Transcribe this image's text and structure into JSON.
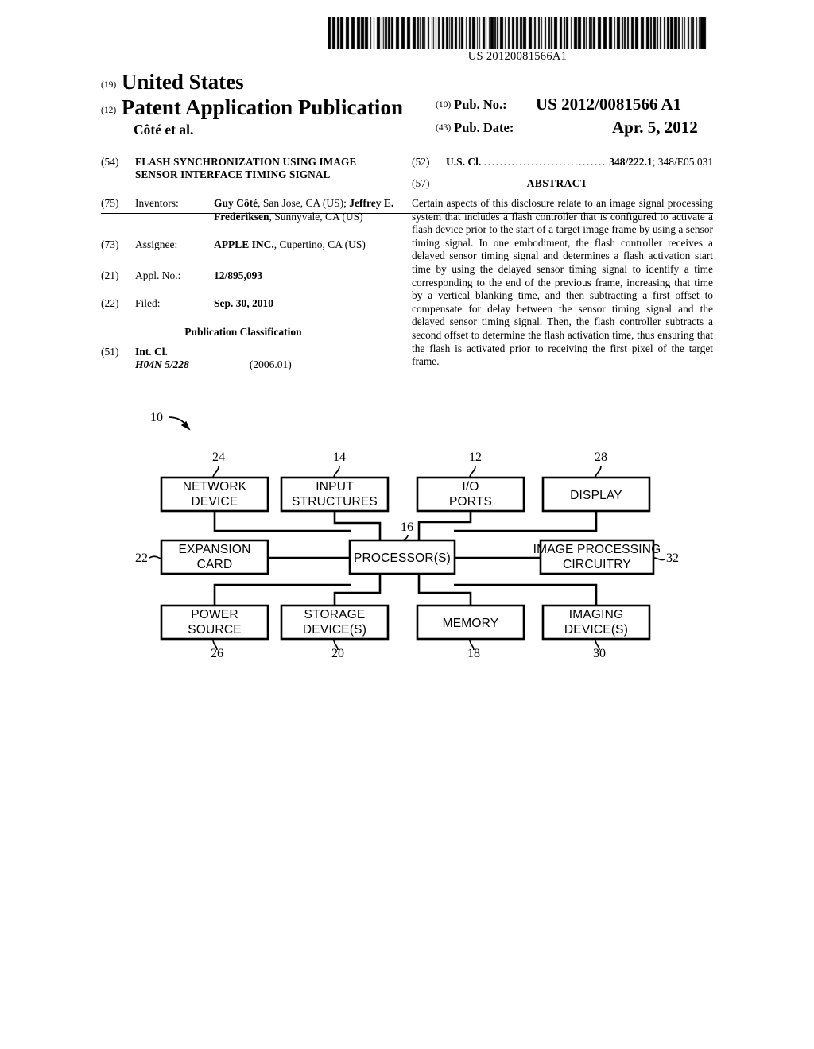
{
  "barcode": {
    "number": "US 20120081566A1"
  },
  "header": {
    "code_19": "(19)",
    "country": "United States",
    "code_12": "(12)",
    "doc_type": "Patent Application Publication",
    "author": "Côté et al.",
    "code_10": "(10)",
    "pubno_label": "Pub. No.:",
    "pubno_value": "US 2012/0081566 A1",
    "code_43": "(43)",
    "pubdate_label": "Pub. Date:",
    "pubdate_value": "Apr. 5, 2012"
  },
  "left": {
    "title_code": "(54)",
    "title": "FLASH SYNCHRONIZATION USING IMAGE SENSOR INTERFACE TIMING SIGNAL",
    "inventors_code": "(75)",
    "inventors_label": "Inventors:",
    "inventor1_name": "Guy Côté",
    "inventor1_loc": ", San Jose, CA (US);",
    "inventor2_name": "Jeffrey E. Frederiksen",
    "inventor2_loc": ", Sunnyvale, CA (US)",
    "assignee_code": "(73)",
    "assignee_label": "Assignee:",
    "assignee_name": "APPLE INC.",
    "assignee_loc": ", Cupertino, CA (US)",
    "appl_code": "(21)",
    "appl_label": "Appl. No.:",
    "appl_value": "12/895,093",
    "filed_code": "(22)",
    "filed_label": "Filed:",
    "filed_value": "Sep. 30, 2010",
    "pubclass_heading": "Publication Classification",
    "intcl_code": "(51)",
    "intcl_label": "Int. Cl.",
    "intcl_class": "H04N 5/228",
    "intcl_version": "(2006.01)"
  },
  "right": {
    "uscl_code": "(52)",
    "uscl_label": "U.S. Cl.",
    "uscl_dots": "...............................",
    "uscl_primary": "348/222.1",
    "uscl_secondary": "; 348/E05.031",
    "abstract_code": "(57)",
    "abstract_heading": "ABSTRACT",
    "abstract_text": "Certain aspects of this disclosure relate to an image signal processing system that includes a flash controller that is configured to activate a flash device prior to the start of a target image frame by using a sensor timing signal. In one embodiment, the flash controller receives a delayed sensor timing signal and determines a flash activation start time by using the delayed sensor timing signal to identify a time corresponding to the end of the previous frame, increasing that time by a vertical blanking time, and then subtracting a first offset to compensate for delay between the sensor timing signal and the delayed sensor timing signal. Then, the flash controller subtracts a second offset to determine the flash activation time, thus ensuring that the flash is activated prior to receiving the first pixel of the target frame."
  },
  "figure": {
    "figure_ref": "10",
    "blocks": {
      "network_device": {
        "line1": "NETWORK",
        "line2": "DEVICE",
        "ref": "24"
      },
      "input_structures": {
        "line1": "INPUT",
        "line2": "STRUCTURES",
        "ref": "14"
      },
      "io_ports": {
        "line1": "I/O",
        "line2": "PORTS",
        "ref": "12"
      },
      "display": {
        "line1": "DISPLAY",
        "line2": "",
        "ref": "28"
      },
      "expansion_card": {
        "line1": "EXPANSION",
        "line2": "CARD",
        "ref": "22"
      },
      "processor": {
        "line1": "PROCESSOR(S)",
        "line2": "",
        "ref": "16"
      },
      "image_processing": {
        "line1": "IMAGE  PROCESSING",
        "line2": "CIRCUITRY",
        "ref": "32"
      },
      "power_source": {
        "line1": "POWER",
        "line2": "SOURCE",
        "ref": "26"
      },
      "storage_devices": {
        "line1": "STORAGE",
        "line2": "DEVICE(S)",
        "ref": "20"
      },
      "memory": {
        "line1": "MEMORY",
        "line2": "",
        "ref": "18"
      },
      "imaging_devices": {
        "line1": "IMAGING",
        "line2": "DEVICE(S)",
        "ref": "30"
      }
    }
  }
}
